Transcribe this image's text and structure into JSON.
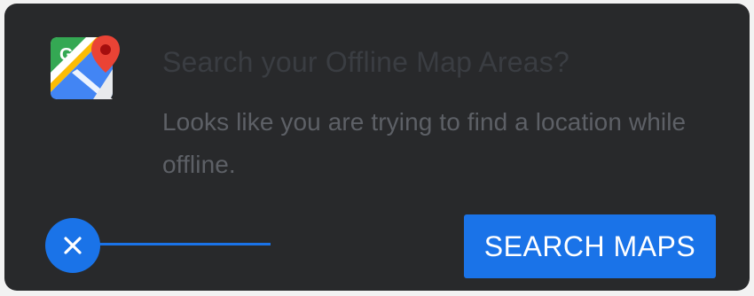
{
  "dialog": {
    "app_icon": "google-maps-icon",
    "logo_letter": "G",
    "title": "Search your Offline Map Areas?",
    "body": "Looks like you are trying to find a location while offline.",
    "dismiss_icon": "close-icon",
    "search_button_label": "SEARCH MAPS"
  },
  "colors": {
    "card_background": "#28292b",
    "accent": "#1a73e8",
    "title_text": "#3a3d42",
    "body_text": "#5d6066",
    "button_text": "#ffffff"
  }
}
